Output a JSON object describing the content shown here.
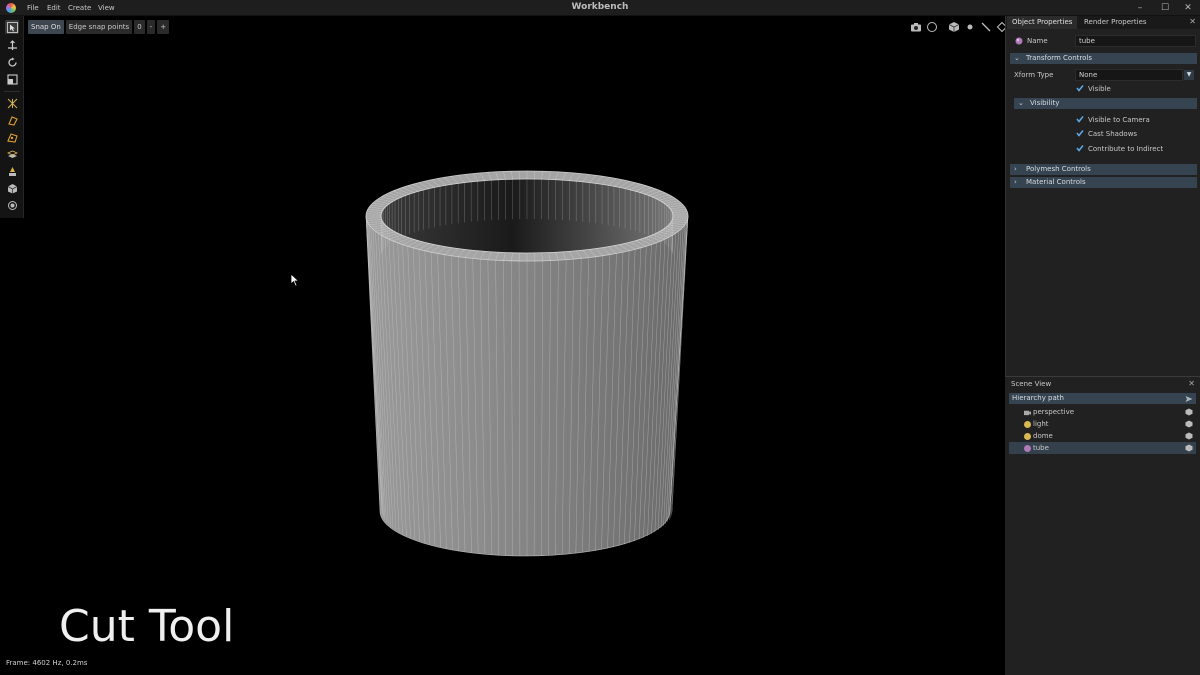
{
  "window": {
    "title": "Workbench",
    "menu": [
      "File",
      "Edit",
      "Create",
      "View"
    ],
    "controls": [
      "–",
      "☐",
      "✕"
    ]
  },
  "toolbar": {
    "snap_on": "Snap On",
    "edge_snap_points": "Edge snap points",
    "snap_value": "0",
    "decrement": "-",
    "increment": "+"
  },
  "viewport": {
    "overlay_title": "Cut Tool",
    "frame_status": "Frame: 4602 Hz,   0.2ms"
  },
  "properties": {
    "tabs": [
      "Object Properties",
      "Render Properties"
    ],
    "close": "✕",
    "name_label": "Name",
    "name_value": "tube",
    "transform_controls": "Transform Controls",
    "xform_type_label": "Xform Type",
    "xform_type_value": "None",
    "visible_label": "Visible",
    "visibility_section": "Visibility",
    "visible_to_camera": "Visible to Camera",
    "cast_shadows": "Cast Shadows",
    "contribute_to_indirect": "Contribute to Indirect",
    "polymesh_controls": "Polymesh Controls",
    "material_controls": "Material Controls"
  },
  "scene_view": {
    "title": "Scene View",
    "close": "✕",
    "hierarchy_header": "Hierarchy path",
    "items": [
      {
        "label": "perspective",
        "icon": "camera-icon"
      },
      {
        "label": "light",
        "icon": "light-bulb-icon"
      },
      {
        "label": "dome",
        "icon": "light-bulb-icon"
      },
      {
        "label": "tube",
        "icon": "mesh-icon",
        "selected": true
      }
    ]
  },
  "colors": {
    "accent": "#364350",
    "check": "#5fa8e8",
    "background": "#000000"
  }
}
